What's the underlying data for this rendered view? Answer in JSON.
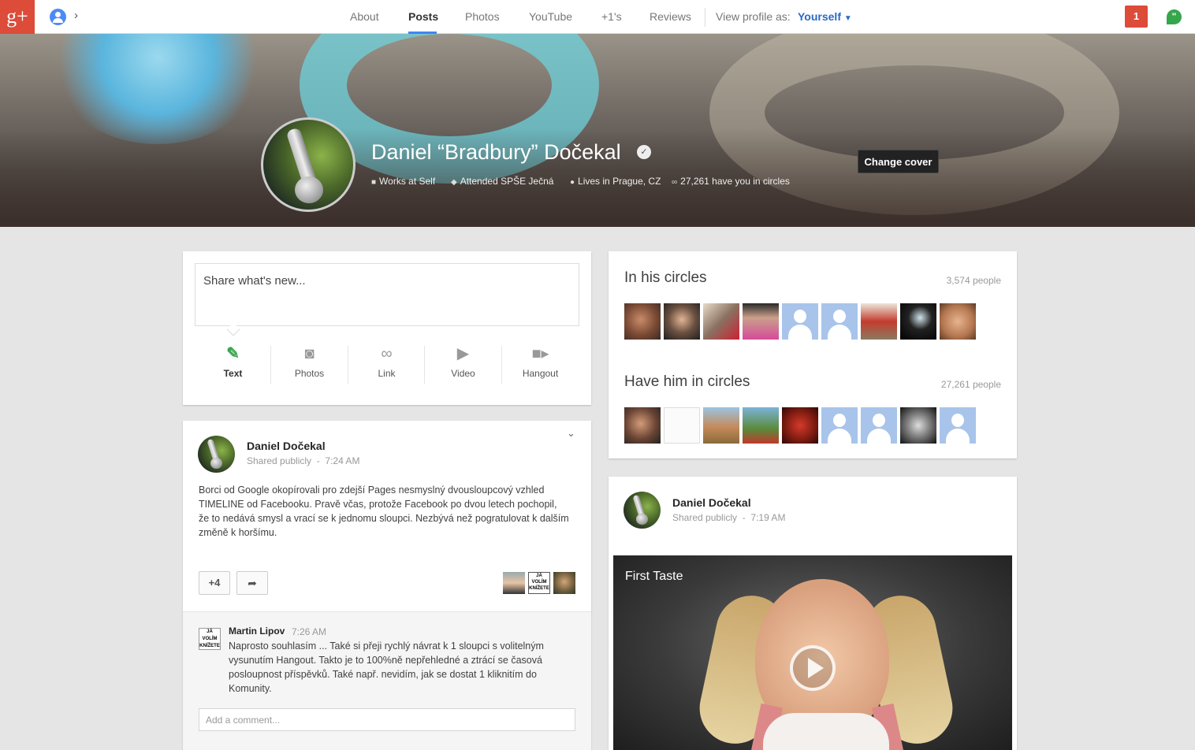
{
  "app": {
    "logo": "g+"
  },
  "nav": {
    "tabs": [
      {
        "label": "About"
      },
      {
        "label": "Posts"
      },
      {
        "label": "Photos"
      },
      {
        "label": "YouTube"
      },
      {
        "label": "+1's"
      },
      {
        "label": "Reviews"
      }
    ],
    "active_tab": "Posts",
    "view_as_label": "View profile as:",
    "view_as_value": "Yourself",
    "notifications": "1"
  },
  "profile": {
    "name": "Daniel “Bradbury” Dočekal",
    "works": "Works at Self",
    "attended": "Attended SPŠE Ječná",
    "lives": "Lives in Prague, CZ",
    "circled_by": "27,261 have you in circles",
    "change_cover": "Change cover"
  },
  "share": {
    "placeholder": "Share what's new...",
    "options": [
      {
        "label": "Text",
        "icon": "pencil-icon"
      },
      {
        "label": "Photos",
        "icon": "camera-icon"
      },
      {
        "label": "Link",
        "icon": "link-icon"
      },
      {
        "label": "Video",
        "icon": "video-icon"
      },
      {
        "label": "Hangout",
        "icon": "hangout-camera-icon"
      }
    ]
  },
  "post1": {
    "author": "Daniel Dočekal",
    "visibility": "Shared publicly",
    "separator": "-",
    "time": "7:24 AM",
    "text": "Borci od Google okopírovali pro zdejší Pages nesmyslný dvousloupcový vzhled TIMELINE od Facebooku. Pravě včas, protože Facebook po dvou letech pochopil, že to nedává smysl a vrací se k jednomu sloupci. Nezbývá než pogratulovat k dalším změně k horšímu.",
    "plus_count": "+4",
    "comment": {
      "author": "Martin Lipov",
      "time": "7:26 AM",
      "avatar_text": "JÁ VOLÍM KNÍŽETE",
      "text": "Naprosto souhlasím ... Také si přeji rychlý návrat k 1 sloupci s volitelným vysunutím Hangout.  Takto je to 100%ně nepřehledné a ztrácí se časová posloupnost příspěvků. Také např. nevidím, jak se dostat 1 kliknitím do Komunity."
    },
    "comment_placeholder": "Add a comment..."
  },
  "circles": {
    "in_his": {
      "title": "In his circles",
      "count": "3,574 people"
    },
    "have_him": {
      "title": "Have him in circles",
      "count": "27,261 people"
    }
  },
  "post2": {
    "author": "Daniel Dočekal",
    "visibility": "Shared publicly",
    "separator": "-",
    "time": "7:19 AM",
    "video_title": "First Taste"
  }
}
